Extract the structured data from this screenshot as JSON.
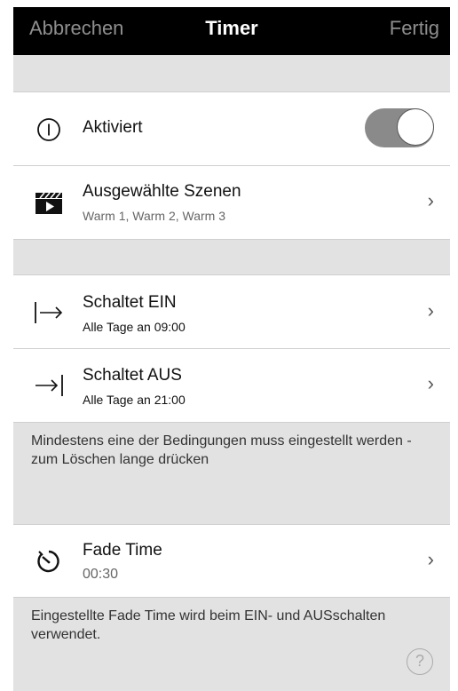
{
  "nav": {
    "cancel_label": "Abbrechen",
    "title": "Timer",
    "done_label": "Fertig"
  },
  "activated": {
    "label": "Aktiviert",
    "toggle_state": "on"
  },
  "scenes": {
    "title": "Ausgewählte Szenen",
    "value": "Warm 1, Warm 2, Warm 3"
  },
  "switch_on": {
    "title": "Schaltet EIN",
    "value": "Alle Tage an 09:00"
  },
  "switch_off": {
    "title": "Schaltet AUS",
    "value": "Alle Tage an 21:00"
  },
  "conditions_note": "Mindestens eine der Bedingungen muss eingestellt werden - zum Löschen lange drücken",
  "fade": {
    "title": "Fade Time",
    "value": "00:30"
  },
  "fade_note": "Eingestellte Fade Time wird beim EIN- und AUSschalten verwendet.",
  "icons": {
    "power": "power-icon",
    "scene": "clapperboard-icon",
    "switch_on": "arrow-right-from-bar-icon",
    "switch_off": "arrow-right-to-bar-icon",
    "fade": "timer-icon",
    "help": "help-icon",
    "chevron": "chevron-right-icon"
  },
  "help_glyph": "?",
  "chevron_glyph": "›"
}
